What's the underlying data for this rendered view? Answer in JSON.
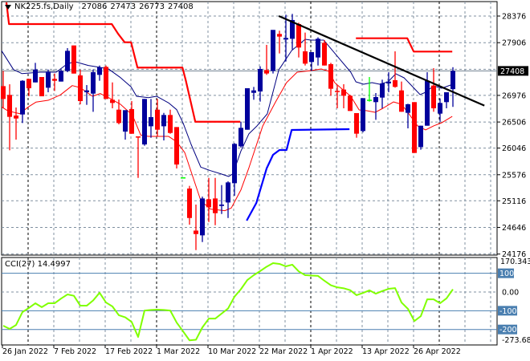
{
  "header": {
    "symbol": "NK225.fs,Daily",
    "open": "27086",
    "high": "27473",
    "low": "26773",
    "close": "27408"
  },
  "cci_label": {
    "name": "CCI(27)",
    "value": "14.4997"
  },
  "colors": {
    "up": "#00009c",
    "down": "#ff0000",
    "doji": "#00ff00",
    "ma_fast": "#000080",
    "ma_slow": "#ff0000",
    "stop_upper": "#ff0000",
    "stop_lower": "#0000ff",
    "trend": "#000000",
    "cci": "#80ff00",
    "level_line": "#4a7fb0"
  },
  "chart_data": [
    {
      "type": "candlestick",
      "title": "NK225.fs,Daily",
      "price_ticks": [
        "28376",
        "27906",
        "26976",
        "26506",
        "26046",
        "25576",
        "25116",
        "24646",
        "24176"
      ],
      "current_price": "27408",
      "ylim": [
        24176,
        28376
      ],
      "date_labels": [
        "26 Jan 2022",
        "7 Feb 2022",
        "17 Feb 2022",
        "1 Mar 2022",
        "10 Mar 2022",
        "22 Mar 2022",
        "1 Apr 2022",
        "13 Apr 2022",
        "26 Apr 2022"
      ],
      "ohlc": [
        [
          27139,
          27408,
          26748,
          26913
        ],
        [
          26984,
          27172,
          26007,
          26597
        ],
        [
          26620,
          26762,
          26195,
          26568
        ],
        [
          26639,
          27243,
          26488,
          27234
        ],
        [
          27267,
          27267,
          26960,
          27102
        ],
        [
          27205,
          27550,
          27205,
          27432
        ],
        [
          27300,
          27300,
          26960,
          26960
        ],
        [
          27111,
          27432,
          27031,
          27394
        ],
        [
          27267,
          27361,
          27054,
          27234
        ],
        [
          27220,
          27432,
          27220,
          27408
        ],
        [
          27408,
          27810,
          27385,
          27762
        ],
        [
          27857,
          27857,
          27361,
          27361
        ],
        [
          27328,
          27426,
          26819,
          26875
        ],
        [
          27031,
          27158,
          26809,
          27064
        ],
        [
          27007,
          27432,
          26686,
          27385
        ],
        [
          27338,
          27503,
          27234,
          27470
        ],
        [
          27479,
          27503,
          26913,
          26913
        ],
        [
          26899,
          27205,
          26748,
          26842
        ],
        [
          26724,
          26903,
          26465,
          26488
        ],
        [
          26337,
          26715,
          26195,
          26715
        ],
        [
          26734,
          26875,
          26299,
          26299
        ],
        [
          26252,
          26252,
          25520,
          26242
        ],
        [
          26110,
          26913,
          26087,
          26913
        ],
        [
          26431,
          26913,
          26228,
          26592
        ],
        [
          26724,
          26913,
          26252,
          26370
        ],
        [
          26431,
          26667,
          26181,
          26630
        ],
        [
          26630,
          26724,
          26299,
          26313
        ],
        [
          26417,
          26417,
          25686,
          25756
        ],
        [
          25530,
          25530,
          25530,
          25530
        ],
        [
          25332,
          25379,
          24694,
          24812
        ],
        [
          24590,
          25049,
          24246,
          24529
        ],
        [
          24506,
          25190,
          24388,
          25157
        ],
        [
          25143,
          25520,
          24741,
          25001
        ],
        [
          25157,
          25520,
          24685,
          24897
        ],
        [
          25025,
          25393,
          24883,
          25049
        ],
        [
          25086,
          25459,
          24812,
          25440
        ],
        [
          25426,
          26134,
          25204,
          26120
        ],
        [
          26077,
          26512,
          26054,
          26403
        ],
        [
          26370,
          27102,
          26370,
          27102
        ],
        [
          27021,
          27125,
          26899,
          27064
        ],
        [
          27045,
          27489,
          26866,
          27442
        ],
        [
          27423,
          27867,
          27338,
          27362
        ],
        [
          27409,
          28131,
          27362,
          28131
        ],
        [
          28060,
          28117,
          27716,
          28013
        ],
        [
          27961,
          28400,
          27574,
          27989
        ],
        [
          27975,
          28414,
          27786,
          28306
        ],
        [
          28235,
          28258,
          27645,
          27820
        ],
        [
          27753,
          28084,
          27503,
          27536
        ],
        [
          27565,
          27739,
          27409,
          27739
        ],
        [
          27645,
          28000,
          27503,
          27975
        ],
        [
          27904,
          27951,
          27503,
          27503
        ],
        [
          27527,
          27550,
          26970,
          27093
        ],
        [
          27055,
          27149,
          26748,
          27036
        ],
        [
          27079,
          27173,
          26748,
          26970
        ],
        [
          26970,
          26984,
          26701,
          26701
        ],
        [
          26663,
          26663,
          26229,
          26300
        ],
        [
          26347,
          26927,
          26323,
          26927
        ],
        [
          26899,
          27300,
          26866,
          26899
        ],
        [
          26857,
          27017,
          26545,
          26946
        ],
        [
          26937,
          27253,
          26748,
          27187
        ],
        [
          27187,
          27385,
          27031,
          27220
        ],
        [
          27244,
          27753,
          27112,
          27126
        ],
        [
          27064,
          27220,
          26687,
          26687
        ],
        [
          26668,
          26828,
          26394,
          26819
        ],
        [
          26857,
          26857,
          25960,
          25960
        ],
        [
          26064,
          26441,
          26017,
          26441
        ],
        [
          26441,
          27385,
          26441,
          27234
        ],
        [
          27149,
          27456,
          26687,
          26748
        ],
        [
          26654,
          26922,
          26512,
          26842
        ],
        [
          26857,
          27031,
          26748,
          27031
        ],
        [
          27086,
          27473,
          26773,
          27408
        ]
      ],
      "ma_fast": [
        [
          -0.25,
          27763
        ],
        [
          1.6,
          27432
        ],
        [
          2.9,
          27361
        ],
        [
          5.75,
          27385
        ],
        [
          8.25,
          27385
        ],
        [
          9.9,
          27527
        ],
        [
          11.1,
          27573
        ],
        [
          13.25,
          27503
        ],
        [
          15.1,
          27470
        ],
        [
          16.4,
          27441
        ],
        [
          18.25,
          27290
        ],
        [
          19.9,
          27126
        ],
        [
          20.75,
          26960
        ],
        [
          22.6,
          26936
        ],
        [
          23.9,
          26960
        ],
        [
          25.75,
          26843
        ],
        [
          27,
          26724
        ],
        [
          28,
          26489
        ],
        [
          29.25,
          26111
        ],
        [
          30.75,
          25710
        ],
        [
          32.25,
          25648
        ],
        [
          33.9,
          25591
        ],
        [
          35.1,
          25545
        ],
        [
          35.75,
          25591
        ],
        [
          37,
          25993
        ],
        [
          38.25,
          26299
        ],
        [
          39.5,
          26437
        ],
        [
          41.1,
          26649
        ],
        [
          42.9,
          27427
        ],
        [
          44.9,
          27767
        ],
        [
          47,
          27965
        ],
        [
          47.9,
          27951
        ],
        [
          49.9,
          27951
        ],
        [
          52,
          27668
        ],
        [
          54.1,
          27385
        ],
        [
          54.9,
          27215
        ],
        [
          56.1,
          27173
        ],
        [
          57.4,
          27201
        ],
        [
          58.6,
          27173
        ],
        [
          59.9,
          27215
        ],
        [
          61.1,
          27357
        ],
        [
          62.4,
          27286
        ],
        [
          63.6,
          27144
        ],
        [
          64.9,
          26989
        ],
        [
          65.75,
          27031
        ],
        [
          67,
          27144
        ],
        [
          68.25,
          27102
        ],
        [
          70,
          27173
        ]
      ],
      "ma_slow": [
        [
          -0.25,
          26772
        ],
        [
          0.75,
          26701
        ],
        [
          2.6,
          26653
        ],
        [
          3.9,
          26772
        ],
        [
          5.1,
          26857
        ],
        [
          7,
          26889
        ],
        [
          8.9,
          26984
        ],
        [
          10.75,
          27149
        ],
        [
          12,
          27112
        ],
        [
          13.9,
          26960
        ],
        [
          15.1,
          27008
        ],
        [
          16.4,
          26936
        ],
        [
          18.25,
          26819
        ],
        [
          20.1,
          26630
        ],
        [
          21.4,
          26276
        ],
        [
          22.6,
          26252
        ],
        [
          25.75,
          26252
        ],
        [
          27,
          26158
        ],
        [
          28.25,
          25969
        ],
        [
          29.5,
          25545
        ],
        [
          30.75,
          25120
        ],
        [
          32.25,
          24969
        ],
        [
          34.5,
          24941
        ],
        [
          35.5,
          24988
        ],
        [
          37,
          25308
        ],
        [
          38.25,
          25700
        ],
        [
          40.4,
          26437
        ],
        [
          42.4,
          26861
        ],
        [
          44.1,
          27201
        ],
        [
          45.75,
          27385
        ],
        [
          47.9,
          27413
        ],
        [
          49.5,
          27442
        ],
        [
          50.75,
          27399
        ],
        [
          51.6,
          27201
        ],
        [
          52.9,
          27074
        ],
        [
          54.1,
          26960
        ],
        [
          55.4,
          26720
        ],
        [
          56.6,
          26705
        ],
        [
          57.9,
          26677
        ],
        [
          59.1,
          26748
        ],
        [
          60.75,
          26861
        ],
        [
          62,
          26819
        ],
        [
          63.25,
          26635
        ],
        [
          64.5,
          26437
        ],
        [
          65.75,
          26366
        ],
        [
          67,
          26437
        ],
        [
          68.25,
          26493
        ],
        [
          69.9,
          26606
        ]
      ],
      "stop_upper": [
        [
          0.5,
          28617
        ],
        [
          0.9,
          28234
        ],
        [
          16.9,
          28234
        ],
        [
          17.9,
          28060
        ],
        [
          18.9,
          27913
        ],
        [
          19.9,
          27913
        ],
        [
          20.9,
          27466
        ],
        [
          27.9,
          27466
        ],
        [
          28.4,
          27250
        ],
        [
          29.9,
          26511
        ],
        [
          36.9,
          26511
        ]
      ],
      "stop_upper_2": [
        [
          54.9,
          27984
        ],
        [
          62.9,
          27984
        ],
        [
          63.9,
          27749
        ],
        [
          69.9,
          27749
        ]
      ],
      "stop_lower": [
        [
          37.9,
          24766
        ],
        [
          39.4,
          25077
        ],
        [
          41,
          25686
        ],
        [
          42,
          25927
        ],
        [
          43,
          26012
        ],
        [
          44.1,
          26012
        ],
        [
          44.9,
          26366
        ],
        [
          53.9,
          26380
        ]
      ],
      "trendline": [
        [
          42.9,
          28376
        ],
        [
          74.9,
          26795
        ]
      ]
    },
    {
      "type": "line",
      "title": "CCI(27)",
      "ylim": [
        -273.68,
        170.3435
      ],
      "range_labels": [
        "170.3435",
        "-273.680"
      ],
      "levels": [
        {
          "value": 100,
          "label": "100"
        },
        {
          "value": 0,
          "label": "0.00"
        },
        {
          "value": -100,
          "label": "-100"
        },
        {
          "value": -200,
          "label": "-200"
        }
      ],
      "values": [
        -180,
        -197,
        -176,
        -107,
        -85,
        -60,
        -81,
        -60,
        -60,
        -35,
        -13,
        -20,
        -73,
        -73,
        -45,
        -4,
        -56,
        -77,
        -124,
        -135,
        -160,
        -240,
        -99,
        -96,
        -94,
        -96,
        -99,
        -163,
        -210,
        -258,
        -255,
        -189,
        -142,
        -142,
        -115,
        -88,
        -25,
        15,
        64,
        90,
        112,
        135,
        154,
        150,
        137,
        146,
        110,
        90,
        88,
        86,
        60,
        36,
        25,
        20,
        10,
        -17,
        -5,
        9,
        -9,
        5,
        17,
        21,
        -56,
        -90,
        -155,
        -129,
        -39,
        -39,
        -60,
        -34,
        14.4997
      ]
    }
  ]
}
